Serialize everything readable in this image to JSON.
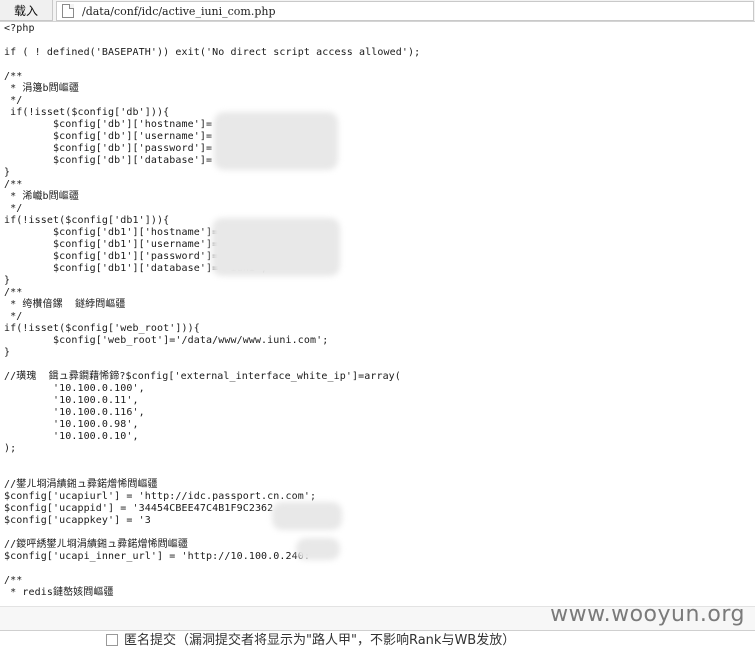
{
  "toolbar": {
    "load_label": "载入",
    "file_path": "/data/conf/idc/active_iuni_com.php"
  },
  "code_lines": [
    "<?php",
    "",
    "if ( ! defined('BASEPATH')) exit('No direct script access allowed');",
    "",
    "/**",
    " * 涓籩b閰嶇疆",
    " */",
    " if(!isset($config['db'])){",
    "        $config['db']['hostname']= '10.100.0.250",
    "        $config['db']['username']= '",
    "        $config['db']['password']= '",
    "        $config['db']['database']= '",
    "}",
    "/**",
    " * 浠巇b閰嶇疆",
    " */",
    "if(!isset($config['db1'])){",
    "        $config['db1']['hostname']= '10.100.0.250",
    "        $config['db1']['username']=",
    "        $config['db1']['password']=",
    "        $config['db1']['database']= 'iuni';",
    "}",
    "/**",
    " * 绔欑偣鏍  鐩綍閰嶇疆",
    " */",
    "if(!isset($config['web_root'])){",
    "        $config['web_root']='/data/www/www.iuni.com';",
    "}",
    "",
    "//璜瑰  鍓ュ彛鐧藉悕鍗?$config['external_interface_white_ip']=array(",
    "        '10.100.0.100',",
    "        '10.100.0.11',",
    "        '10.100.0.116',",
    "        '10.100.0.98',",
    "        '10.100.0.10',",
    ");",
    "",
    "",
    "//鐢ㄦ埛涓績鎺ュ彛鍩熷悕閰嶇疆",
    "$config['ucapiurl'] = 'http://idc.passport.cn.com';",
    "$config['ucappid'] = '34454CBEE47C4B1F9C2362",
    "$config['ucappkey'] = '3",
    "",
    "//鍐呯綉鐢ㄦ埛涓績鎺ュ彛鍩熷悕閰嶇疆",
    "$config['ucapi_inner_url'] = 'http://10.100.0.240:",
    "",
    "/**",
    " * redis鏈嶅姟閰嶇疆"
  ],
  "watermark": "www.wooyun.org",
  "bottom_text": "匿名提交（漏洞提交者将显示为\"路人甲\"，不影响Rank与WB发放）"
}
